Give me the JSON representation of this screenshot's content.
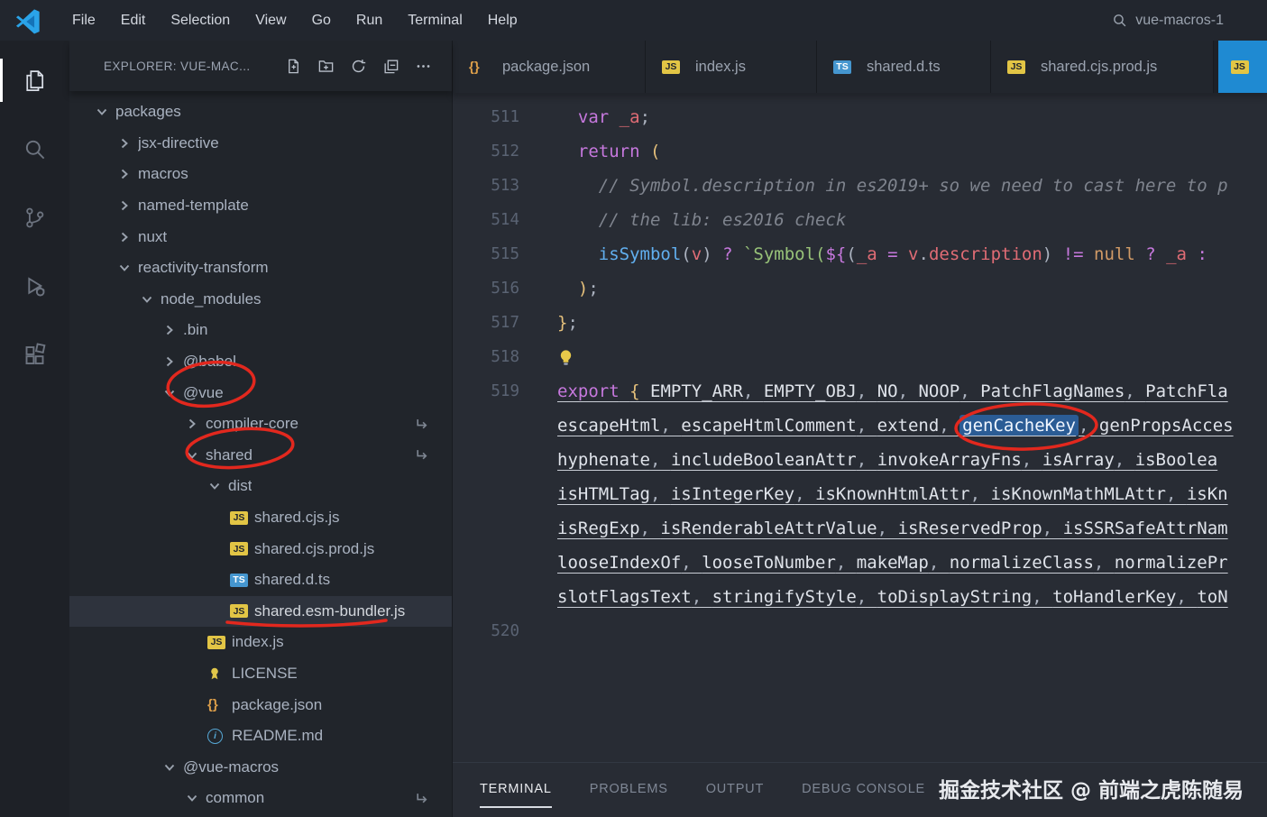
{
  "title_bar": {
    "menus": [
      "File",
      "Edit",
      "Selection",
      "View",
      "Go",
      "Run",
      "Terminal",
      "Help"
    ],
    "search_text": "vue-macros-1"
  },
  "activity_bar": {
    "items": [
      {
        "name": "explorer",
        "label": "Explorer",
        "active": true
      },
      {
        "name": "search",
        "label": "Search",
        "active": false
      },
      {
        "name": "source-control",
        "label": "Source Control",
        "active": false
      },
      {
        "name": "run-debug",
        "label": "Run and Debug",
        "active": false
      },
      {
        "name": "extensions",
        "label": "Extensions",
        "active": false
      }
    ]
  },
  "sidebar": {
    "header_title": "EXPLORER: VUE-MAC...",
    "actions": [
      "new-file",
      "new-folder",
      "refresh",
      "collapse-all",
      "more"
    ],
    "tree": [
      {
        "label": "packages",
        "indent": 0,
        "chevron": "down"
      },
      {
        "label": "jsx-directive",
        "indent": 1,
        "chevron": "right"
      },
      {
        "label": "macros",
        "indent": 1,
        "chevron": "right"
      },
      {
        "label": "named-template",
        "indent": 1,
        "chevron": "right"
      },
      {
        "label": "nuxt",
        "indent": 1,
        "chevron": "right"
      },
      {
        "label": "reactivity-transform",
        "indent": 1,
        "chevron": "down"
      },
      {
        "label": "node_modules",
        "indent": 2,
        "chevron": "down"
      },
      {
        "label": ".bin",
        "indent": 3,
        "chevron": "right"
      },
      {
        "label": "@babel",
        "indent": 3,
        "chevron": "right"
      },
      {
        "label": "@vue",
        "indent": 3,
        "chevron": "down",
        "annotated": true
      },
      {
        "label": "compiler-core",
        "indent": 4,
        "chevron": "right",
        "symlink": true
      },
      {
        "label": "shared",
        "indent": 4,
        "chevron": "down",
        "symlink": true,
        "annotated": true
      },
      {
        "label": "dist",
        "indent": 5,
        "chevron": "down"
      },
      {
        "label": "shared.cjs.js",
        "indent": 6,
        "icon": "js"
      },
      {
        "label": "shared.cjs.prod.js",
        "indent": 6,
        "icon": "js"
      },
      {
        "label": "shared.d.ts",
        "indent": 6,
        "icon": "ts"
      },
      {
        "label": "shared.esm-bundler.js",
        "indent": 6,
        "icon": "js",
        "selected": true,
        "annotated": true
      },
      {
        "label": "index.js",
        "indent": 5,
        "icon": "js"
      },
      {
        "label": "LICENSE",
        "indent": 5,
        "icon": "license"
      },
      {
        "label": "package.json",
        "indent": 5,
        "icon": "json"
      },
      {
        "label": "README.md",
        "indent": 5,
        "icon": "readme"
      },
      {
        "label": "@vue-macros",
        "indent": 3,
        "chevron": "down"
      },
      {
        "label": "common",
        "indent": 4,
        "chevron": "down",
        "symlink": true
      }
    ]
  },
  "tabs": [
    {
      "icon": "json",
      "label": "package.json",
      "active": false
    },
    {
      "icon": "js",
      "label": "index.js",
      "active": false
    },
    {
      "icon": "ts",
      "label": "shared.d.ts",
      "active": false
    },
    {
      "icon": "js",
      "label": "shared.cjs.prod.js",
      "active": false
    },
    {
      "icon": "js",
      "label": "",
      "active": true
    }
  ],
  "editor": {
    "lines": [
      {
        "num": "511",
        "tokens": [
          [
            "pu",
            "  "
          ],
          [
            "kw",
            "var"
          ],
          [
            "pu",
            " "
          ],
          [
            "vr",
            "_a"
          ],
          [
            "pu",
            ";"
          ]
        ]
      },
      {
        "num": "512",
        "tokens": [
          [
            "pu",
            "  "
          ],
          [
            "kw",
            "return"
          ],
          [
            "br",
            " ("
          ]
        ]
      },
      {
        "num": "513",
        "tokens": [
          [
            "cm",
            "    // Symbol.description in es2019+ so we need to cast here to p"
          ]
        ]
      },
      {
        "num": "514",
        "tokens": [
          [
            "cm",
            "    // the lib: es2016 check"
          ]
        ]
      },
      {
        "num": "515",
        "tokens": [
          [
            "pu",
            "    "
          ],
          [
            "fn",
            "isSymbol"
          ],
          [
            "pu",
            "("
          ],
          [
            "vr",
            "v"
          ],
          [
            "pu",
            ")"
          ],
          [
            "kw",
            " ? "
          ],
          [
            "st",
            "`Symbol("
          ],
          [
            "kw",
            "${"
          ],
          [
            "pu",
            "("
          ],
          [
            "vr",
            "_a"
          ],
          [
            "kw",
            " = "
          ],
          [
            "vr",
            "v"
          ],
          [
            "pu",
            "."
          ],
          [
            "vr",
            "description"
          ],
          [
            "pu",
            ")"
          ],
          [
            "kw",
            " != "
          ],
          [
            "nm",
            "null"
          ],
          [
            "kw",
            " ? "
          ],
          [
            "vr",
            "_a"
          ],
          [
            "kw",
            " : "
          ]
        ]
      },
      {
        "num": "516",
        "tokens": [
          [
            "br",
            "  )"
          ],
          [
            "pu",
            ";"
          ]
        ]
      },
      {
        "num": "517",
        "tokens": [
          [
            "br",
            "}"
          ],
          [
            "pu",
            ";"
          ]
        ]
      },
      {
        "num": "518",
        "bulb": true,
        "tokens": []
      },
      {
        "num": "519",
        "uline": true,
        "tokens": [
          [
            "kw",
            "export"
          ],
          [
            "pu",
            " "
          ],
          [
            "br",
            "{"
          ],
          [
            "pu",
            " "
          ],
          [
            "id",
            "EMPTY_ARR"
          ],
          [
            "pu",
            ", "
          ],
          [
            "id",
            "EMPTY_OBJ"
          ],
          [
            "pu",
            ", "
          ],
          [
            "id",
            "NO"
          ],
          [
            "pu",
            ", "
          ],
          [
            "id",
            "NOOP"
          ],
          [
            "pu",
            ", "
          ],
          [
            "id",
            "PatchFlagNames"
          ],
          [
            "pu",
            ", "
          ],
          [
            "id",
            "PatchFla"
          ]
        ]
      },
      {
        "num": "",
        "uline": true,
        "tokens": [
          [
            "id",
            "escapeHtml"
          ],
          [
            "pu",
            ", "
          ],
          [
            "id",
            "escapeHtmlComment"
          ],
          [
            "pu",
            ", "
          ],
          [
            "id",
            "extend"
          ],
          [
            "pu",
            ", "
          ],
          [
            "hl",
            "genCacheKey"
          ],
          [
            "pu",
            ", "
          ],
          [
            "id",
            "genPropsAcces"
          ]
        ]
      },
      {
        "num": "",
        "uline": true,
        "tokens": [
          [
            "id",
            "hyphenate"
          ],
          [
            "pu",
            ", "
          ],
          [
            "id",
            "includeBooleanAttr"
          ],
          [
            "pu",
            ", "
          ],
          [
            "id",
            "invokeArrayFns"
          ],
          [
            "pu",
            ", "
          ],
          [
            "id",
            "isArray"
          ],
          [
            "pu",
            ", "
          ],
          [
            "id",
            "isBoolea"
          ]
        ]
      },
      {
        "num": "",
        "uline": true,
        "tokens": [
          [
            "id",
            "isHTMLTag"
          ],
          [
            "pu",
            ", "
          ],
          [
            "id",
            "isIntegerKey"
          ],
          [
            "pu",
            ", "
          ],
          [
            "id",
            "isKnownHtmlAttr"
          ],
          [
            "pu",
            ", "
          ],
          [
            "id",
            "isKnownMathMLAttr"
          ],
          [
            "pu",
            ", "
          ],
          [
            "id",
            "isKn"
          ]
        ]
      },
      {
        "num": "",
        "uline": true,
        "tokens": [
          [
            "id",
            "isRegExp"
          ],
          [
            "pu",
            ", "
          ],
          [
            "id",
            "isRenderableAttrValue"
          ],
          [
            "pu",
            ", "
          ],
          [
            "id",
            "isReservedProp"
          ],
          [
            "pu",
            ", "
          ],
          [
            "id",
            "isSSRSafeAttrNam"
          ]
        ]
      },
      {
        "num": "",
        "uline": true,
        "tokens": [
          [
            "id",
            "looseIndexOf"
          ],
          [
            "pu",
            ", "
          ],
          [
            "id",
            "looseToNumber"
          ],
          [
            "pu",
            ", "
          ],
          [
            "id",
            "makeMap"
          ],
          [
            "pu",
            ", "
          ],
          [
            "id",
            "normalizeClass"
          ],
          [
            "pu",
            ", "
          ],
          [
            "id",
            "normalizePr"
          ]
        ]
      },
      {
        "num": "",
        "uline": true,
        "tokens": [
          [
            "id",
            "slotFlagsText"
          ],
          [
            "pu",
            ", "
          ],
          [
            "id",
            "stringifyStyle"
          ],
          [
            "pu",
            ", "
          ],
          [
            "id",
            "toDisplayString"
          ],
          [
            "pu",
            ", "
          ],
          [
            "id",
            "toHandlerKey"
          ],
          [
            "pu",
            ", "
          ],
          [
            "id",
            "toN"
          ]
        ]
      },
      {
        "num": "520",
        "tokens": []
      }
    ]
  },
  "panel": {
    "tabs": [
      {
        "label": "TERMINAL",
        "active": true
      },
      {
        "label": "PROBLEMS",
        "active": false
      },
      {
        "label": "OUTPUT",
        "active": false
      },
      {
        "label": "DEBUG CONSOLE",
        "active": false
      }
    ],
    "watermark": "掘金技术社区 @ 前端之虎陈随易"
  },
  "colors": {
    "accent_blue": "#1f8ad2",
    "occurrence_highlight": "#2b5c95",
    "annotation_red": "#e2281e"
  }
}
